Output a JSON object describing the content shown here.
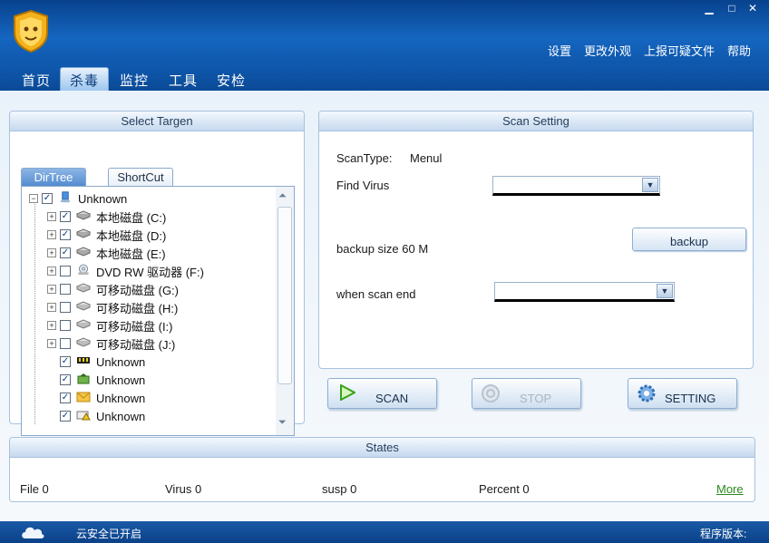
{
  "window": {
    "minimize": "▁",
    "maximize": "□",
    "close": "✕"
  },
  "top_links": [
    "设置",
    "更改外观",
    "上报可疑文件",
    "帮助"
  ],
  "nav_tabs": [
    "首页",
    "杀毒",
    "监控",
    "工具",
    "安检"
  ],
  "select_panel": {
    "title": "Select Targen",
    "tabs": [
      "DirTree",
      "ShortCut"
    ],
    "tree": [
      {
        "label": "Unknown",
        "checked": true,
        "icon": "computer-icon",
        "expand": "−"
      },
      {
        "label": "本地磁盘 (C:)",
        "checked": true,
        "icon": "disk-icon",
        "expand": "+"
      },
      {
        "label": "本地磁盘 (D:)",
        "checked": true,
        "icon": "disk-icon",
        "expand": "+"
      },
      {
        "label": "本地磁盘 (E:)",
        "checked": true,
        "icon": "disk-icon",
        "expand": "+"
      },
      {
        "label": "DVD RW 驱动器 (F:)",
        "checked": false,
        "icon": "dvd-icon",
        "expand": "+"
      },
      {
        "label": "可移动磁盘 (G:)",
        "checked": false,
        "icon": "removable-disk-icon",
        "expand": "+"
      },
      {
        "label": "可移动磁盘 (H:)",
        "checked": false,
        "icon": "removable-disk-icon",
        "expand": "+"
      },
      {
        "label": "可移动磁盘 (I:)",
        "checked": false,
        "icon": "removable-disk-icon",
        "expand": "+"
      },
      {
        "label": "可移动磁盘 (J:)",
        "checked": false,
        "icon": "removable-disk-icon",
        "expand": "+"
      },
      {
        "label": "Unknown",
        "checked": true,
        "icon": "memory-icon",
        "expand": ""
      },
      {
        "label": "Unknown",
        "checked": true,
        "icon": "startup-icon",
        "expand": ""
      },
      {
        "label": "Unknown",
        "checked": true,
        "icon": "mail-icon",
        "expand": ""
      },
      {
        "label": "Unknown",
        "checked": true,
        "icon": "warning-folder-icon",
        "expand": ""
      }
    ]
  },
  "scan_setting": {
    "title": "Scan Setting",
    "scan_type_label": "ScanType:",
    "scan_type_value": "Menul",
    "find_virus_label": "Find Virus",
    "find_virus_value": "",
    "backup_size": "backup size 60 M",
    "backup_button": "backup",
    "when_scan_end_label": "when scan end",
    "when_scan_end_value": ""
  },
  "actions": {
    "scan": "SCAN",
    "stop": "STOP",
    "setting": "SETTING"
  },
  "states": {
    "title": "States",
    "file": "File 0",
    "virus": "Virus 0",
    "susp": "susp 0",
    "percent": "Percent 0",
    "more": "More"
  },
  "statusbar": {
    "cloud": "云安全已开启",
    "version": "程序版本:"
  },
  "colors": {
    "brand_blue": "#0b4a97",
    "panel_border": "#a8c2de",
    "more_link": "#2a8a1e"
  }
}
